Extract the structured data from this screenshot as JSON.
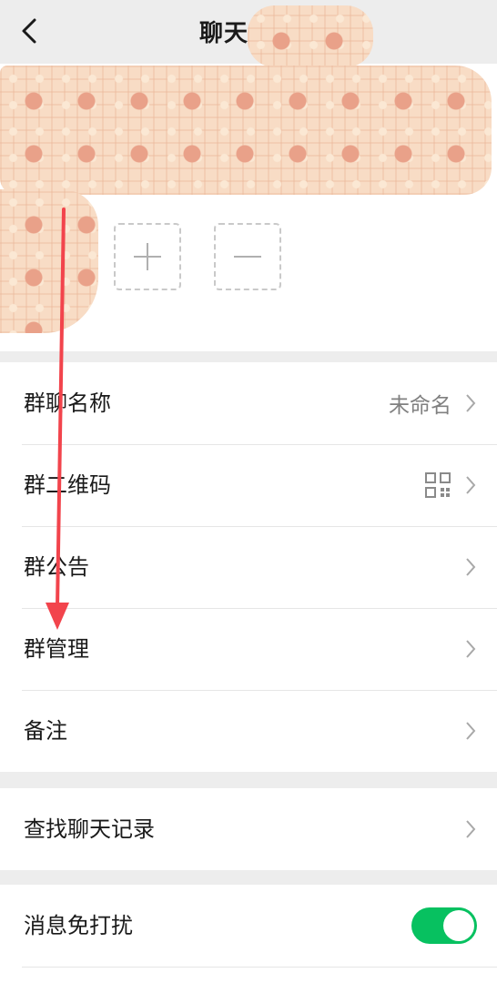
{
  "header": {
    "title": "聊天信息"
  },
  "groups": [
    {
      "rows": [
        {
          "label": "群聊名称",
          "value": "未命名"
        },
        {
          "label": "群二维码"
        },
        {
          "label": "群公告"
        },
        {
          "label": "群管理"
        },
        {
          "label": "备注"
        }
      ]
    },
    {
      "rows": [
        {
          "label": "查找聊天记录"
        }
      ]
    },
    {
      "rows": [
        {
          "label": "消息免打扰"
        }
      ]
    }
  ],
  "toggles": {
    "mute_enabled": true
  },
  "colors": {
    "background": "#ededed",
    "accent_green": "#07c160",
    "annotation_arrow": "#f2444c",
    "sticker": "#f8dcc5"
  },
  "icons": {
    "back": "chevron-left-icon",
    "add_member": "plus-icon",
    "remove_member": "minus-icon",
    "qr": "qr-code-icon",
    "row_arrow": "chevron-right-icon"
  }
}
